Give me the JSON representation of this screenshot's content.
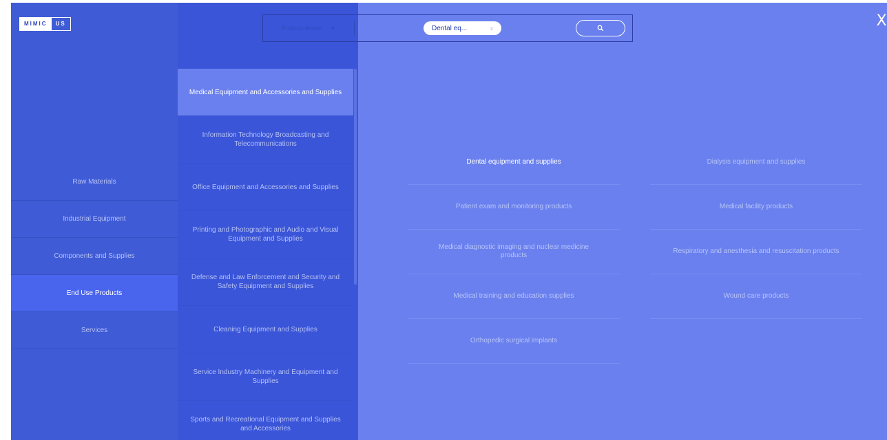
{
  "logo": {
    "part1": "MIMIC",
    "part2": "US"
  },
  "search": {
    "mode_label": "Product-driven",
    "chip_text": "Dental eq...",
    "chip_close": "x"
  },
  "close_label": "X",
  "level1": [
    {
      "label": "Raw Materials",
      "active": false
    },
    {
      "label": "Industrial Equipment",
      "active": false
    },
    {
      "label": "Components and Supplies",
      "active": false
    },
    {
      "label": "End Use Products",
      "active": true
    },
    {
      "label": "Services",
      "active": false
    }
  ],
  "level2": [
    {
      "label": "Medical Equipment and Accessories and Supplies",
      "active": true
    },
    {
      "label": "Information Technology Broadcasting and Telecommunications",
      "active": false
    },
    {
      "label": "Office Equipment and Accessories and Supplies",
      "active": false
    },
    {
      "label": "Printing and Photographic and Audio and Visual Equipment and Supplies",
      "active": false
    },
    {
      "label": "Defense and Law Enforcement and Security and Safety Equipment and Supplies",
      "active": false
    },
    {
      "label": "Cleaning Equipment and Supplies",
      "active": false
    },
    {
      "label": "Service Industry Machinery and Equipment and Supplies",
      "active": false
    },
    {
      "label": "Sports and Recreational Equipment and Supplies and Accessories",
      "active": false
    }
  ],
  "level3": [
    {
      "label": "Dental equipment and supplies",
      "active": true
    },
    {
      "label": "Dialysis equipment and supplies",
      "active": false
    },
    {
      "label": "Patient exam and monitoring products",
      "active": false
    },
    {
      "label": "Medical facility products",
      "active": false
    },
    {
      "label": "Medical diagnostic imaging and nuclear medicine products",
      "active": false
    },
    {
      "label": "Respiratory and anesthesia and resuscitation products",
      "active": false
    },
    {
      "label": "Medical training and education supplies",
      "active": false
    },
    {
      "label": "Wound care products",
      "active": false
    },
    {
      "label": "Orthopedic surgical implants",
      "active": false
    }
  ]
}
